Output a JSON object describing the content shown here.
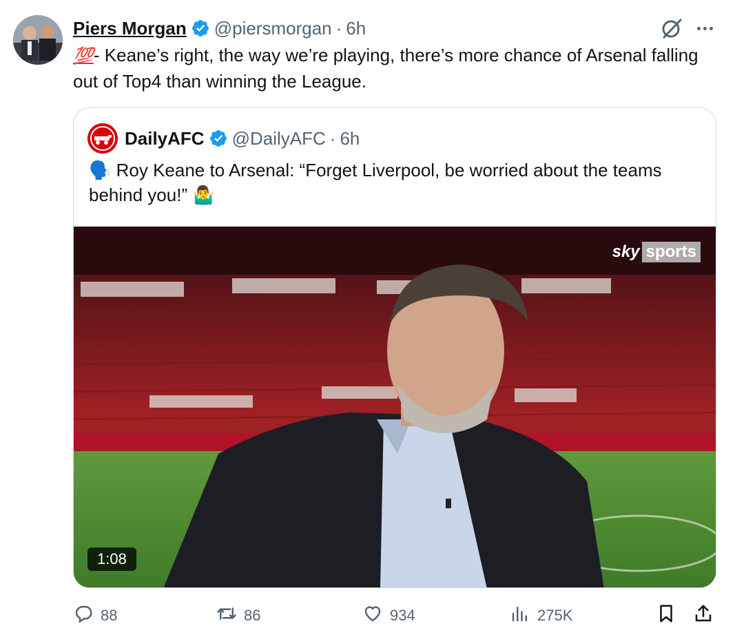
{
  "tweet": {
    "author_name": "Piers Morgan",
    "handle": "@piersmorgan",
    "time": "6h",
    "emoji": "💯",
    "text_after_emoji": "- Keane’s right, the way we’re playing, there’s more chance of Arsenal falling out of Top4 than winning the League."
  },
  "quoted_tweet": {
    "author_name": "DailyAFC",
    "handle": "@DailyAFC",
    "time": "6h",
    "speaking_emoji": "🗣️",
    "text": "Roy Keane to Arsenal: “Forget Liverpool, be worried about the teams behind you!”",
    "trailing_emoji": "🤷‍♂️",
    "video": {
      "duration": "1:08",
      "watermark_sky": "sky",
      "watermark_sports": "sports"
    }
  },
  "actions": {
    "replies": "88",
    "reposts": "86",
    "likes": "934",
    "views": "275K"
  },
  "icons": [
    "verified-icon",
    "grok-icon",
    "more-icon",
    "reply-icon",
    "repost-icon",
    "like-icon",
    "views-icon",
    "bookmark-icon",
    "share-icon"
  ],
  "colors": {
    "verified": "#1d9bf0",
    "muted_text": "#536471",
    "border": "#cfd9de",
    "arsenal_red": "#db0007"
  }
}
